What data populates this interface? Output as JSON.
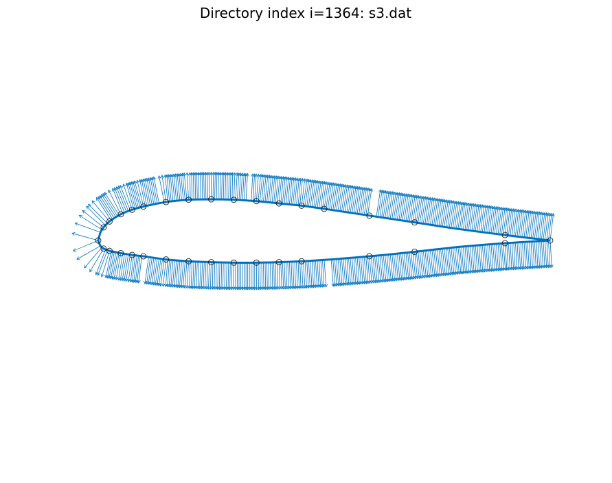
{
  "title": "Directory index i=1364: s3.dat",
  "colors": {
    "curve": "#0072BD",
    "vectors": "#0072BD",
    "markers_edge": "#1a1a1a",
    "background": "#ffffff"
  },
  "chart_data": {
    "type": "scatter",
    "title": "Directory index i=1364: s3.dat",
    "xlabel": "",
    "ylabel": "",
    "axis_visible": false,
    "grid": false,
    "xlim": [
      -0.04,
      1.04
    ],
    "ylim": [
      -0.5,
      0.55
    ],
    "series": [
      {
        "kind": "airfoil-outline",
        "upper": [
          [
            0.0,
            0.0
          ],
          [
            0.005,
            0.018
          ],
          [
            0.012,
            0.029
          ],
          [
            0.025,
            0.042
          ],
          [
            0.05,
            0.058
          ],
          [
            0.075,
            0.068
          ],
          [
            0.1,
            0.075
          ],
          [
            0.15,
            0.085
          ],
          [
            0.2,
            0.09
          ],
          [
            0.25,
            0.091
          ],
          [
            0.3,
            0.09
          ],
          [
            0.35,
            0.087
          ],
          [
            0.4,
            0.082
          ],
          [
            0.45,
            0.077
          ],
          [
            0.5,
            0.07
          ],
          [
            0.6,
            0.055
          ],
          [
            0.7,
            0.04
          ],
          [
            0.8,
            0.025
          ],
          [
            0.9,
            0.012
          ],
          [
            1.0,
            0.0
          ]
        ],
        "lower": [
          [
            0.0,
            0.0
          ],
          [
            0.005,
            -0.012
          ],
          [
            0.012,
            -0.018
          ],
          [
            0.025,
            -0.023
          ],
          [
            0.05,
            -0.028
          ],
          [
            0.075,
            -0.032
          ],
          [
            0.1,
            -0.035
          ],
          [
            0.15,
            -0.042
          ],
          [
            0.2,
            -0.046
          ],
          [
            0.25,
            -0.048
          ],
          [
            0.3,
            -0.049
          ],
          [
            0.35,
            -0.049
          ],
          [
            0.4,
            -0.048
          ],
          [
            0.45,
            -0.046
          ],
          [
            0.5,
            -0.043
          ],
          [
            0.6,
            -0.035
          ],
          [
            0.7,
            -0.025
          ],
          [
            0.8,
            -0.014
          ],
          [
            0.9,
            -0.006
          ],
          [
            1.0,
            0.0
          ]
        ]
      },
      {
        "kind": "markers",
        "marker": "circle-open",
        "points": [
          [
            0.0,
            0.0
          ],
          [
            0.012,
            0.029
          ],
          [
            0.025,
            0.042
          ],
          [
            0.05,
            0.058
          ],
          [
            0.075,
            0.068
          ],
          [
            0.1,
            0.075
          ],
          [
            0.15,
            0.085
          ],
          [
            0.2,
            0.09
          ],
          [
            0.25,
            0.091
          ],
          [
            0.3,
            0.09
          ],
          [
            0.35,
            0.087
          ],
          [
            0.4,
            0.082
          ],
          [
            0.45,
            0.077
          ],
          [
            0.5,
            0.07
          ],
          [
            0.6,
            0.055
          ],
          [
            0.7,
            0.04
          ],
          [
            0.9,
            0.012
          ],
          [
            1.0,
            0.0
          ],
          [
            0.012,
            -0.018
          ],
          [
            0.025,
            -0.023
          ],
          [
            0.05,
            -0.028
          ],
          [
            0.075,
            -0.032
          ],
          [
            0.1,
            -0.035
          ],
          [
            0.15,
            -0.042
          ],
          [
            0.2,
            -0.046
          ],
          [
            0.25,
            -0.048
          ],
          [
            0.3,
            -0.049
          ],
          [
            0.35,
            -0.049
          ],
          [
            0.4,
            -0.048
          ],
          [
            0.45,
            -0.046
          ],
          [
            0.6,
            -0.035
          ],
          [
            0.7,
            -0.025
          ],
          [
            0.9,
            -0.006
          ]
        ]
      },
      {
        "kind": "normal-vectors",
        "length": 0.06,
        "description_of_spacing": "dense, one per interpolated surface point",
        "gaps_upper_x": [
          [
            0.137,
            0.143
          ],
          [
            0.328,
            0.337
          ],
          [
            0.6,
            0.615
          ]
        ],
        "gaps_lower_x": [
          [
            0.1,
            0.11
          ],
          [
            0.503,
            0.513
          ]
        ]
      }
    ]
  }
}
